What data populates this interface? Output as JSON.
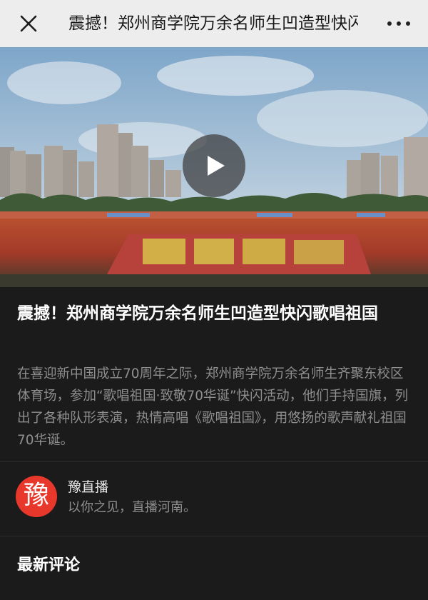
{
  "topbar": {
    "title": "震撼！郑州商学院万余名师生凹造型快闪歌唱祖国",
    "close_icon": "close-icon",
    "more_icon": "more-icon"
  },
  "video": {
    "play_icon": "play-icon"
  },
  "article": {
    "headline": "震撼！郑州商学院万余名师生凹造型快闪歌唱祖国",
    "description": "在喜迎新中国成立70周年之际，郑州商学院万余名师生齐聚东校区体育场，参加“歌唱祖国·致敬70华诞”快闪活动，他们手持国旗，列出了各种队形表演，热情高唱《歌唱祖国》，用悠扬的歌声献礼祖国70华诞。"
  },
  "account": {
    "name": "豫直播",
    "slogan": "以你之见，直播河南。",
    "avatar_glyph": "豫",
    "brand_color": "#e8382b"
  },
  "comments": {
    "title": "最新评论"
  },
  "colors": {
    "background": "#1b1b1b",
    "topbar": "#ededed",
    "secondary_text": "#8e8e8e"
  }
}
